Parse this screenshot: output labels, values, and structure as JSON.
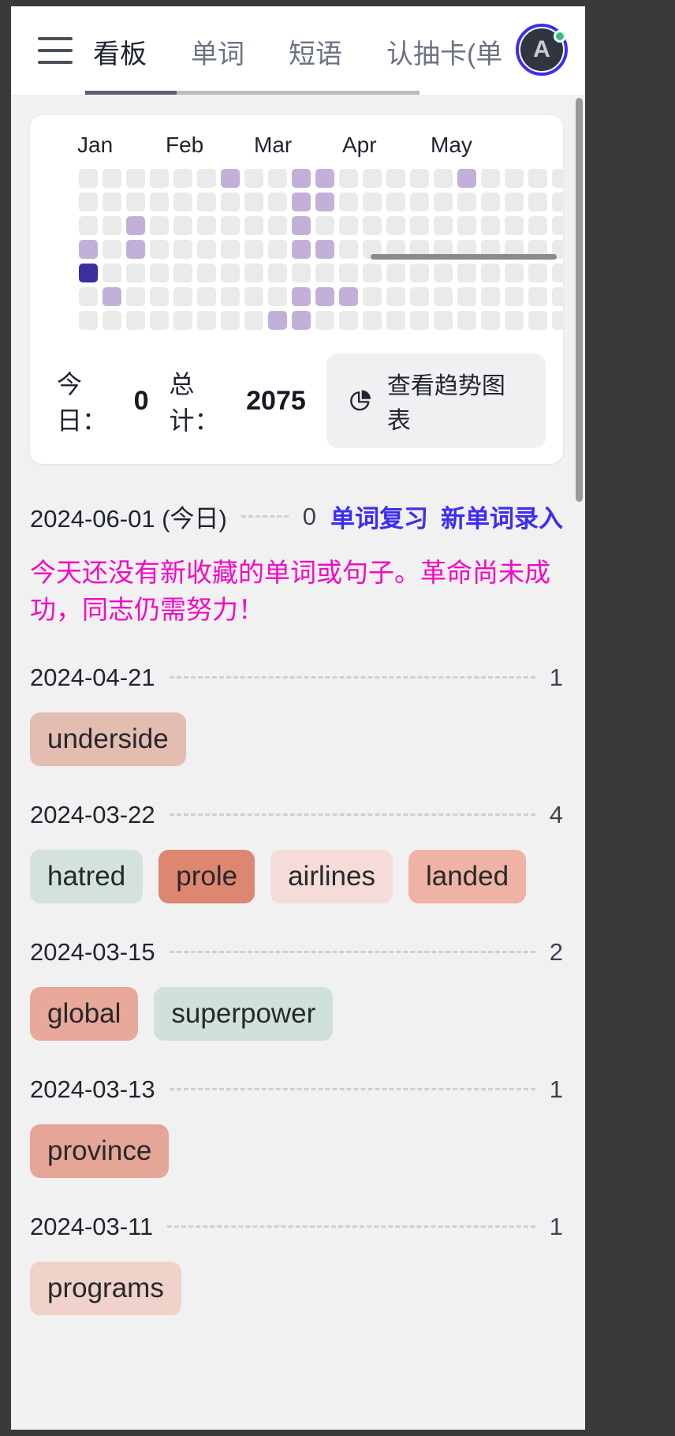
{
  "topbar": {
    "menu_icon": "hamburger-menu-icon",
    "tabs": [
      {
        "label": "看板",
        "active": true
      },
      {
        "label": "单词",
        "active": false
      },
      {
        "label": "短语",
        "active": false
      },
      {
        "label": "认抽卡(单",
        "active": false
      }
    ],
    "avatar": {
      "initial": "A",
      "ring_color": "#3d2df0",
      "status_color": "#34c07f"
    }
  },
  "heatmap": {
    "months": [
      "Jan",
      "Feb",
      "Mar",
      "Apr",
      "May"
    ],
    "rows": 7,
    "columns": 26,
    "levels": {
      "empty": "#eaeaea",
      "low": "#c3b0d8",
      "high": "#3d2f9e"
    },
    "active_cells": [
      {
        "col": 6,
        "row": 0,
        "level": 1
      },
      {
        "col": 9,
        "row": 0,
        "level": 1
      },
      {
        "col": 10,
        "row": 0,
        "level": 1
      },
      {
        "col": 16,
        "row": 0,
        "level": 1
      },
      {
        "col": 9,
        "row": 1,
        "level": 1
      },
      {
        "col": 10,
        "row": 1,
        "level": 1
      },
      {
        "col": 2,
        "row": 2,
        "level": 1
      },
      {
        "col": 9,
        "row": 2,
        "level": 1
      },
      {
        "col": 0,
        "row": 3,
        "level": 1
      },
      {
        "col": 2,
        "row": 3,
        "level": 1
      },
      {
        "col": 9,
        "row": 3,
        "level": 1
      },
      {
        "col": 10,
        "row": 3,
        "level": 1
      },
      {
        "col": 0,
        "row": 4,
        "level": 4
      },
      {
        "col": 1,
        "row": 5,
        "level": 1
      },
      {
        "col": 9,
        "row": 5,
        "level": 1
      },
      {
        "col": 10,
        "row": 5,
        "level": 1
      },
      {
        "col": 11,
        "row": 5,
        "level": 1
      },
      {
        "col": 8,
        "row": 6,
        "level": 1
      },
      {
        "col": 9,
        "row": 6,
        "level": 1
      }
    ]
  },
  "stats": {
    "today_label": "今日：",
    "today_value": "0",
    "total_label": "总计：",
    "total_value": "2075",
    "trend_button": {
      "label": "查看趋势图表",
      "icon": "pie-chart-icon"
    }
  },
  "days": [
    {
      "date": "2024-06-01 (今日)",
      "count": "0",
      "actions": [
        "单词复习",
        "新单词录入"
      ],
      "notice": "今天还没有新收藏的单词或句子。革命尚未成功，同志仍需努力！",
      "tags": []
    },
    {
      "date": "2024-04-21",
      "count": "1",
      "actions": [],
      "notice": "",
      "tags": [
        {
          "word": "underside",
          "color": "#e3bdb0"
        }
      ]
    },
    {
      "date": "2024-03-22",
      "count": "4",
      "actions": [],
      "notice": "",
      "tags": [
        {
          "word": "hatred",
          "color": "#d3e3dc"
        },
        {
          "word": "prole",
          "color": "#dd8670"
        },
        {
          "word": "airlines",
          "color": "#f5dcd8"
        },
        {
          "word": "landed",
          "color": "#eeb3a4"
        }
      ]
    },
    {
      "date": "2024-03-15",
      "count": "2",
      "actions": [],
      "notice": "",
      "tags": [
        {
          "word": "global",
          "color": "#e8a89a"
        },
        {
          "word": "superpower",
          "color": "#cfe1d8"
        }
      ]
    },
    {
      "date": "2024-03-13",
      "count": "1",
      "actions": [],
      "notice": "",
      "tags": [
        {
          "word": "province",
          "color": "#e5a597"
        }
      ]
    },
    {
      "date": "2024-03-11",
      "count": "1",
      "actions": [],
      "notice": "",
      "tags": [
        {
          "word": "programs",
          "color": "#f0d2cb"
        }
      ]
    }
  ]
}
